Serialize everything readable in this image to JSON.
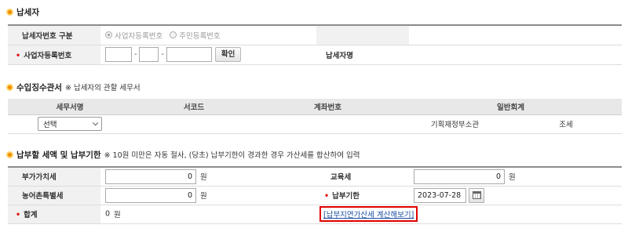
{
  "taxpayer": {
    "title": "납세자",
    "id_type_label": "납세자번호 구분",
    "id_type_options": [
      "사업자등록번호",
      "주민등록번호"
    ],
    "biz_no_label": "사업자등록번호",
    "biz_no_parts": [
      "",
      "",
      ""
    ],
    "confirm_button": "확인",
    "name_label": "납세자명",
    "name_value": ""
  },
  "office": {
    "title": "수입징수관서",
    "note": "※ 납세자의 관할 세무서",
    "headers": [
      "세무서명",
      "서코드",
      "계좌번호",
      "일반회계"
    ],
    "select_value": "선택",
    "code": "",
    "account": "",
    "accounting_manager": "기획재정부소관",
    "accounting_type": "조세"
  },
  "amounts": {
    "title": "납부할 세액 및 납부기한",
    "note": "※ 10원 미만은 자동 절사, (당초) 납부기한이 경과한 경우 가산세를 합산하여 입력",
    "vat_label": "부가가치세",
    "vat_value": "0",
    "edu_label": "교육세",
    "edu_value": "0",
    "rural_label": "농어촌특별세",
    "rural_value": "0",
    "due_label": "납부기한",
    "due_value": "2023-07-28",
    "total_label": "합계",
    "total_value": "0",
    "unit": "원",
    "penalty_link": "[납부지연가산세 계산해보기]"
  },
  "required_mark": "•"
}
